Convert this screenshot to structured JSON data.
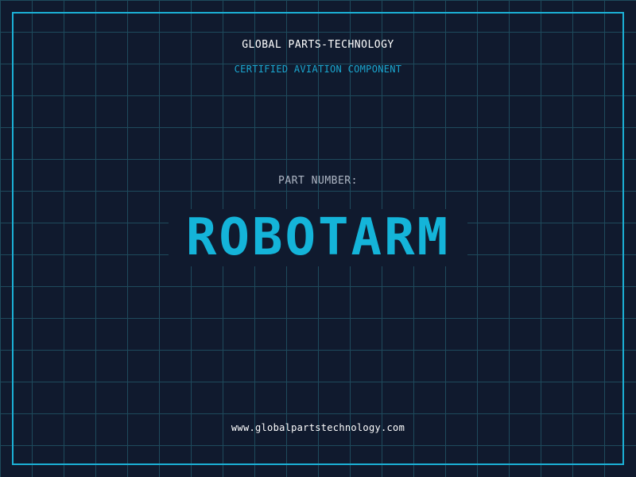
{
  "header": {
    "brand": "GLOBAL PARTS-TECHNOLOGY",
    "subtitle": "CERTIFIED AVIATION COMPONENT"
  },
  "main": {
    "part_label": "PART NUMBER:",
    "part_number": "ROBOTARM"
  },
  "footer": {
    "url": "www.globalpartstechnology.com"
  },
  "colors": {
    "background": "#101a2e",
    "grid": "#1e4a5c",
    "accent": "#1bb0d6",
    "text": "#ffffff",
    "muted": "#aeb6c4"
  }
}
